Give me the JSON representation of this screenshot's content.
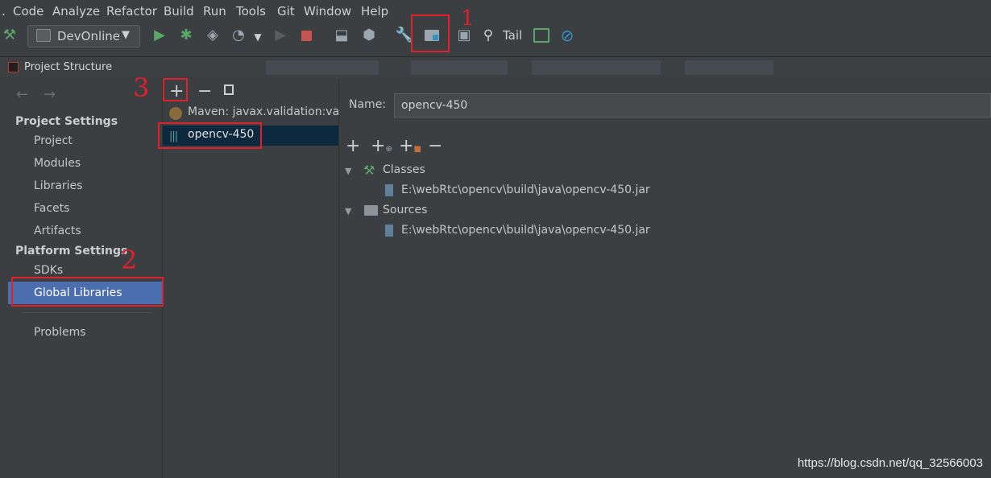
{
  "menu": [
    "Code",
    "Analyze",
    "Refactor",
    "Build",
    "Run",
    "Tools",
    "Git",
    "Window",
    "Help"
  ],
  "toolbar": {
    "run_config": "DevOnline",
    "tail_label": "Tail"
  },
  "dialog": {
    "title": "Project Structure"
  },
  "sidebar": {
    "project_settings_title": "Project Settings",
    "project_items": [
      "Project",
      "Modules",
      "Libraries",
      "Facets",
      "Artifacts"
    ],
    "platform_settings_title": "Platform Settings",
    "platform_items": [
      "SDKs",
      "Global Libraries"
    ],
    "problems": "Problems"
  },
  "libraries": {
    "items": [
      "Maven: javax.validation:valid",
      "opencv-450"
    ]
  },
  "detail": {
    "name_label": "Name:",
    "name_value": "opencv-450",
    "classes_label": "Classes",
    "classes_path": "E:\\webRtc\\opencv\\build\\java\\opencv-450.jar",
    "sources_label": "Sources",
    "sources_path": "E:\\webRtc\\opencv\\build\\java\\opencv-450.jar"
  },
  "annotations": {
    "mark1": "1",
    "mark2": "2",
    "mark3": "3"
  },
  "watermark": "https://blog.csdn.net/qq_32566003",
  "colors": {
    "selection": "#4b6eaf",
    "dark_selection": "#0d293e",
    "annotation_red": "#e0202a"
  }
}
